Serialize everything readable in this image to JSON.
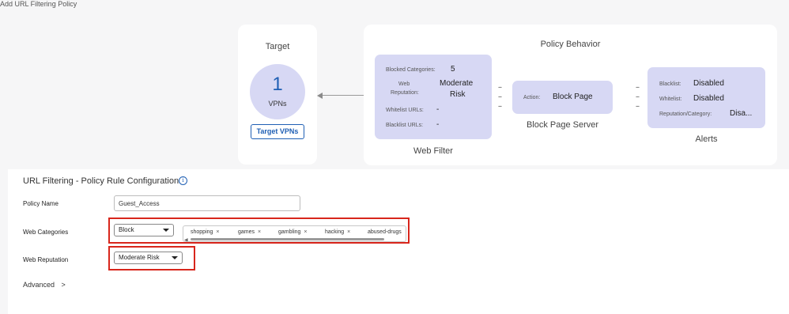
{
  "page": {
    "title": "Add URL Filtering Policy"
  },
  "target": {
    "title": "Target",
    "count": "1",
    "unit": "VPNs",
    "button_label": "Target VPNs"
  },
  "policy_behavior": {
    "title": "Policy Behavior",
    "web_filter": {
      "caption": "Web Filter",
      "blocked_categories_label": "Blocked Categories:",
      "blocked_categories_value": "5",
      "web_reputation_label_1": "Web",
      "web_reputation_label_2": "Reputation:",
      "web_reputation_value_1": "Moderate",
      "web_reputation_value_2": "Risk",
      "whitelist_label": "Whitelist URLs:",
      "whitelist_value": "-",
      "blacklist_label": "Blacklist URLs:",
      "blacklist_value": "-"
    },
    "block_page": {
      "caption": "Block Page Server",
      "action_label": "Action:",
      "action_value": "Block Page"
    },
    "alerts": {
      "caption": "Alerts",
      "blacklist_label": "Blacklist:",
      "blacklist_value": "Disabled",
      "whitelist_label": "Whitelist:",
      "whitelist_value": "Disabled",
      "reputation_label": "Reputation/Category:",
      "reputation_value": "Disa..."
    },
    "connector": "--"
  },
  "config": {
    "title": "URL Filtering - Policy Rule Configuration",
    "info_icon": "info-icon",
    "policy_name_label": "Policy Name",
    "policy_name_value": "Guest_Access",
    "web_categories_label": "Web Categories",
    "web_categories_action": "Block",
    "web_categories_tags": [
      "shopping",
      "games",
      "gambling",
      "hacking",
      "abused-drugs"
    ],
    "web_reputation_label": "Web Reputation",
    "web_reputation_value": "Moderate Risk",
    "advanced_label": "Advanced",
    "advanced_chevron": ">"
  },
  "colors": {
    "accent": "#1f5fb4",
    "box_fill": "#d7d8f4",
    "highlight": "#d8261c"
  }
}
